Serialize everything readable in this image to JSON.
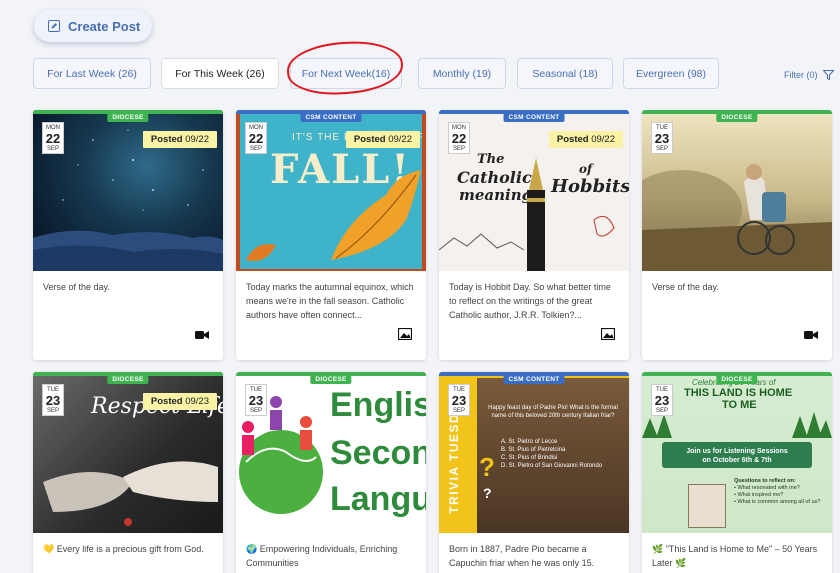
{
  "create_post": {
    "label": "Create Post",
    "icon": "edit-icon"
  },
  "tabs": [
    {
      "label": "For Last Week (26)",
      "active": false
    },
    {
      "label": "For This Week (26)",
      "active": true
    },
    {
      "label": "For Next Week(16)",
      "active": false
    },
    {
      "label": "Monthly (19)",
      "active": false
    },
    {
      "label": "Seasonal (18)",
      "active": false
    },
    {
      "label": "Evergreen (98)",
      "active": false
    }
  ],
  "filter": {
    "label": "Filter (0)",
    "icon": "funnel-icon"
  },
  "colors": {
    "diocese": "#3fb34f",
    "csm": "#3a6ec4",
    "accent": "#4a6fb0",
    "posted_bg": "#faf3a6",
    "annotation": "#e2141c"
  },
  "cards": [
    {
      "tag": "DIOCESE",
      "date": {
        "dow": "MON",
        "day": "22",
        "mon": "SEP"
      },
      "posted": {
        "label": "Posted",
        "date": "09/22"
      },
      "caption": "Verse of the day.",
      "media_icon": "video-icon"
    },
    {
      "tag": "CSM CONTENT",
      "date": {
        "dow": "MON",
        "day": "22",
        "mon": "SEP"
      },
      "posted": {
        "label": "Posted",
        "date": "09/22"
      },
      "image_text": {
        "line1": "IT'S THE FIRST DAY OF",
        "line2": "FALL!"
      },
      "caption": "Today marks the autumnal equinox, which means we're in the fall season. Catholic authors have often connect...",
      "media_icon": "image-icon"
    },
    {
      "tag": "CSM CONTENT",
      "date": {
        "dow": "MON",
        "day": "22",
        "mon": "SEP"
      },
      "posted": {
        "label": "Posted",
        "date": "09/22"
      },
      "image_text": {
        "line1": "The",
        "line2": "Catholic",
        "line3": "meaning",
        "line4": "of",
        "line5": "Hobbits"
      },
      "caption": "Today is Hobbit Day. So what better time to reflect on the writings of the great Catholic author, J.R.R. Tolkien?...",
      "media_icon": "image-icon"
    },
    {
      "tag": "DIOCESE",
      "date": {
        "dow": "TUE",
        "day": "23",
        "mon": "SEP"
      },
      "caption": "Verse of the day.",
      "media_icon": "video-icon"
    },
    {
      "tag": "DIOCESE",
      "date": {
        "dow": "TUE",
        "day": "23",
        "mon": "SEP"
      },
      "posted": {
        "label": "Posted",
        "date": "09/23"
      },
      "image_text": {
        "line1": "Respect Life"
      },
      "caption": "💛 Every life is a precious gift from God."
    },
    {
      "tag": "DIOCESE",
      "date": {
        "dow": "TUE",
        "day": "23",
        "mon": "SEP"
      },
      "image_text": {
        "line1": "English",
        "line2": "Second",
        "line3": "Language"
      },
      "caption": "🌍 Empowering Individuals, Enriching Communities"
    },
    {
      "tag": "CSM CONTENT",
      "date": {
        "dow": "TUE",
        "day": "23",
        "mon": "SEP"
      },
      "image_text": {
        "side": "TRIVIA TUESDAY",
        "question": "Happy feast day of Padre Pio! What is the formal name of this beloved 20th century Italian friar?",
        "a": "A. St. Pietro of Lecce",
        "b": "B. St. Pius of Pietrelcina",
        "c": "C. St. Pius of Brindisi",
        "d": "D. St. Pietro of San Giovanni Rotondo"
      },
      "caption": "Born in 1887, Padre Pio became a Capuchin friar when he was only 15."
    },
    {
      "tag": "DIOCESE",
      "date": {
        "dow": "TUE",
        "day": "23",
        "mon": "SEP"
      },
      "image_text": {
        "script": "Celebrating 20 Years of",
        "title1": "THIS LAND IS HOME",
        "title2": "TO ME",
        "banner1": "Join us for Listening Sessions",
        "banner2": "on October 6th & 7th",
        "q_head": "Questions to reflect on:",
        "q1": "What resonated with me?",
        "q2": "What inspired me?",
        "q3": "What is common among all of us?"
      },
      "caption": "🌿 \"This Land is Home to Me\" – 50 Years Later 🌿"
    }
  ]
}
